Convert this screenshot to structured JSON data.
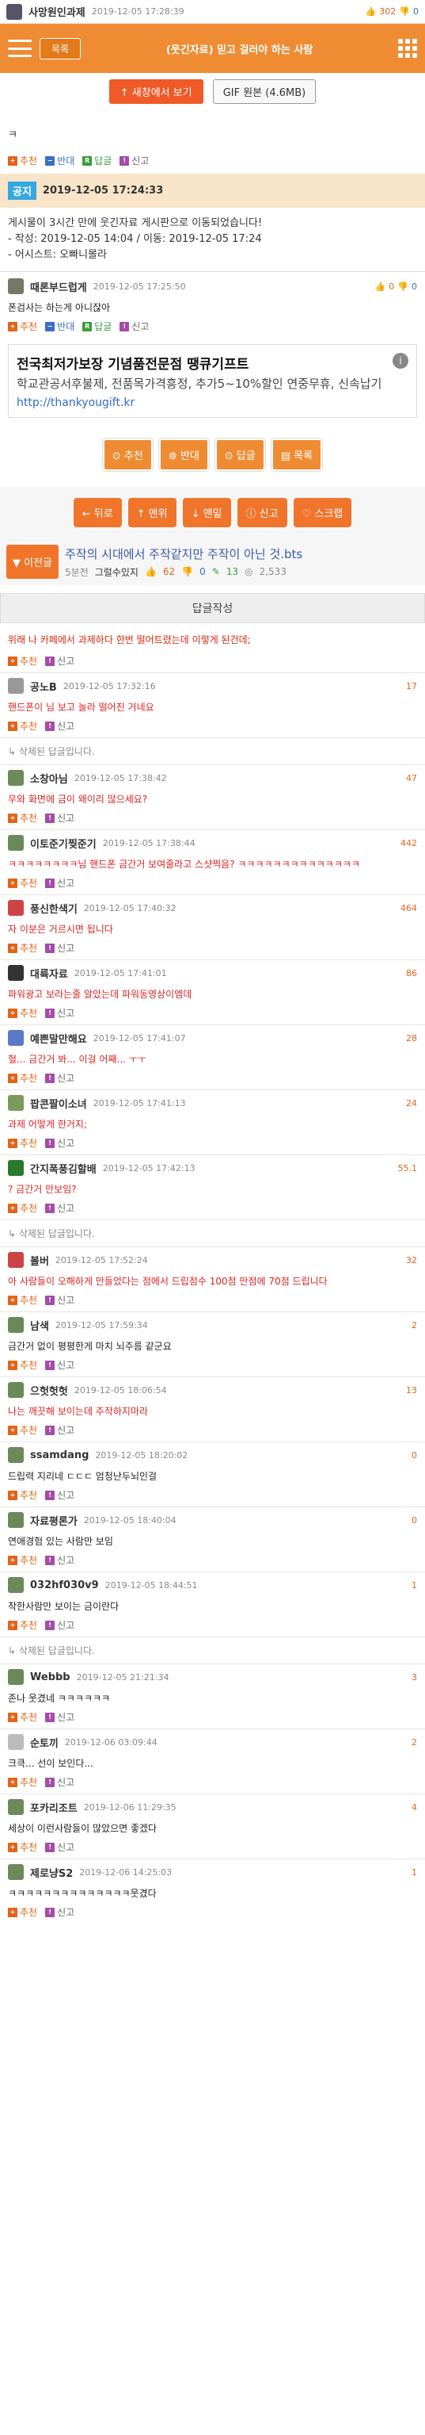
{
  "top": {
    "username": "사망원인과제",
    "date": "2019-12-05 17:28:39",
    "thumbs": "302",
    "like": "0"
  },
  "bar": {
    "list": "목록",
    "title": "(웃긴자료) 믿고 걸러야 하는 사람"
  },
  "buttons": {
    "new_window": "↑ 새창에서 보기",
    "gif": "GIF 원본 (4.6MB)"
  },
  "content": {
    "text": "ㅋ"
  },
  "actions": {
    "recommend": "추천",
    "oppose": "반대",
    "reply": "답글",
    "report": "신고"
  },
  "notice": {
    "badge": "공지",
    "date": "2019-12-05 17:24:33",
    "body": "게시물이 3시간 만에 웃긴자료 게시판으로 이동되었습니다!",
    "post": "- 작성: 2019-12-05 14:04 / 이동: 2019-12-05 17:24",
    "eo": "- 어시스트: 오빠니몰라"
  },
  "first_comment": {
    "user": "때론부드럽게",
    "date": "2019-12-05 17:25:50",
    "up": "0",
    "down": "0",
    "body": "폰검사는 하는게 아니잖아"
  },
  "ad": {
    "title": "전국최저가보장 기념품전문점 땡큐기프트",
    "desc": "학교관공서후불제, 전품목가격흥정, 추가5~10%할인 연중무휴, 신속납기",
    "url": "http://thankyougift.kr",
    "info": "i"
  },
  "obuttons": [
    "⊙ 추천",
    "⊗ 반대",
    "⊙ 답글",
    "▤ 목록"
  ],
  "nav": [
    "← 뒤로",
    "↑ 맨위",
    "↓ 맨밑",
    "ⓘ 신고",
    "♡ 스크랩"
  ],
  "prev": {
    "btn": "▼ 이전글",
    "title": "주작의 시대에서 주작같지만 주작이 아닌 것.bts",
    "meta_user": "그럴수있지",
    "meta_score": "5분전",
    "thumbs": "62",
    "down": "0",
    "replies": "13",
    "views": "2,533"
  },
  "reply_write": "답글작성",
  "reply_prompt": "위래 나 카페에서 과제하다 한번 떨어트렸는데 이렇게 된건데;",
  "deleted_text": "삭제된 답글입니다.",
  "comments": [
    {
      "user": "공노B",
      "date": "2019-12-05 17:32:16",
      "score": "17",
      "body": "핸드폰이 님 보고 놀라 떨어진 거네요",
      "color": "#999"
    },
    {
      "deleted": true
    },
    {
      "user": "소창아님",
      "date": "2019-12-05 17:38:42",
      "score": "47",
      "body": "우와 화면에 금이 왜이리 많으세요?",
      "color": "#6a8a5a"
    },
    {
      "user": "이토준기찢준기",
      "date": "2019-12-05 17:38:44",
      "score": "442",
      "body": "ㅋㅋㅋㅋㅋㅋㅋㅋ님 핸드폰 금간거 보여줄라고 스샷찍음? ㅋㅋㅋㅋㅋㅋㅋㅋㅋㅋㅋㅋㅋㅋ",
      "color": "#6a8a5a"
    },
    {
      "user": "풍신한색기",
      "date": "2019-12-05 17:40:32",
      "score": "464",
      "body": "자 이분은 거르시면 됩니다",
      "color": "#c44"
    },
    {
      "user": "대륙자료",
      "date": "2019-12-05 17:41:01",
      "score": "86",
      "body": "파워광고 보라는줄 알았는데 파워동영상이엠데",
      "color": "#333"
    },
    {
      "user": "예쁜말만해요",
      "date": "2019-12-05 17:41:07",
      "score": "28",
      "body": "헐... 금간거 봐... 이걸 어째... ㅜㅜ",
      "color": "#5a7ac8"
    },
    {
      "user": "팝콘팔이소녀",
      "date": "2019-12-05 17:41:13",
      "score": "24",
      "body": "과제 어떻게 한거지;",
      "color": "#7a9a5a"
    },
    {
      "user": "간지폭풍김할배",
      "date": "2019-12-05 17:42:13",
      "score": "55.1",
      "body": "? 금간거 안보임?",
      "color": "#2a7a2a"
    },
    {
      "deleted": true
    },
    {
      "user": "볼버",
      "date": "2019-12-05 17:52:24",
      "score": "32",
      "body": "아 사람들이 오해하게 만들었다는 점에서 드립점수 100점 만점에 70점 드립니다",
      "color": "#c44"
    },
    {
      "user": "남색",
      "date": "2019-12-05 17:59:34",
      "score": "2",
      "body": "금간거 없이 평평한게 마치 뇌주름 같군요",
      "color": "#6a8a5a",
      "black": true
    },
    {
      "user": "으헛헛헛",
      "date": "2019-12-05 18:06:54",
      "score": "13",
      "body": "나는 깨끗해 보이는데 주작하지마라",
      "color": "#6a8a5a"
    },
    {
      "user": "ssamdang",
      "date": "2019-12-05 18:20:02",
      "score": "0",
      "body": "드립력 지리네 ㄷㄷㄷ 엄청난두뇌인걸",
      "color": "#6a8a5a",
      "black": true
    },
    {
      "user": "자료평론가",
      "date": "2019-12-05 18:40:04",
      "score": "0",
      "body": "연애경험 있는 사람만 보임",
      "color": "#6a8a5a",
      "black": true
    },
    {
      "user": "032hf030v9",
      "date": "2019-12-05 18:44:51",
      "score": "1",
      "body": "착한사람만 보이는 금이란다",
      "color": "#6a8a5a",
      "black": true
    },
    {
      "deleted": true
    },
    {
      "user": "Webbb",
      "date": "2019-12-05 21:21:34",
      "score": "3",
      "body": "존나 웃겼네 ㅋㅋㅋㅋㅋㅋ",
      "color": "#6a8a5a",
      "black": true
    },
    {
      "user": "순토끼",
      "date": "2019-12-06 03:09:44",
      "score": "2",
      "body": "크큭... 선이 보인다...",
      "color": "#bbb",
      "black": true
    },
    {
      "user": "포카리조트",
      "date": "2019-12-06 11:29:35",
      "score": "4",
      "body": "세상이 이런사람들이 많았으면 좋겠다",
      "color": "#6a8a5a",
      "black": true
    },
    {
      "user": "제로냥S2",
      "date": "2019-12-06 14:25:03",
      "score": "1",
      "body": "ㅋㅋㅋㅋㅋㅋㅋㅋㅋㅋㅋㅋㅋㅋ웃겼다",
      "color": "#6a8a5a",
      "black": true
    }
  ]
}
